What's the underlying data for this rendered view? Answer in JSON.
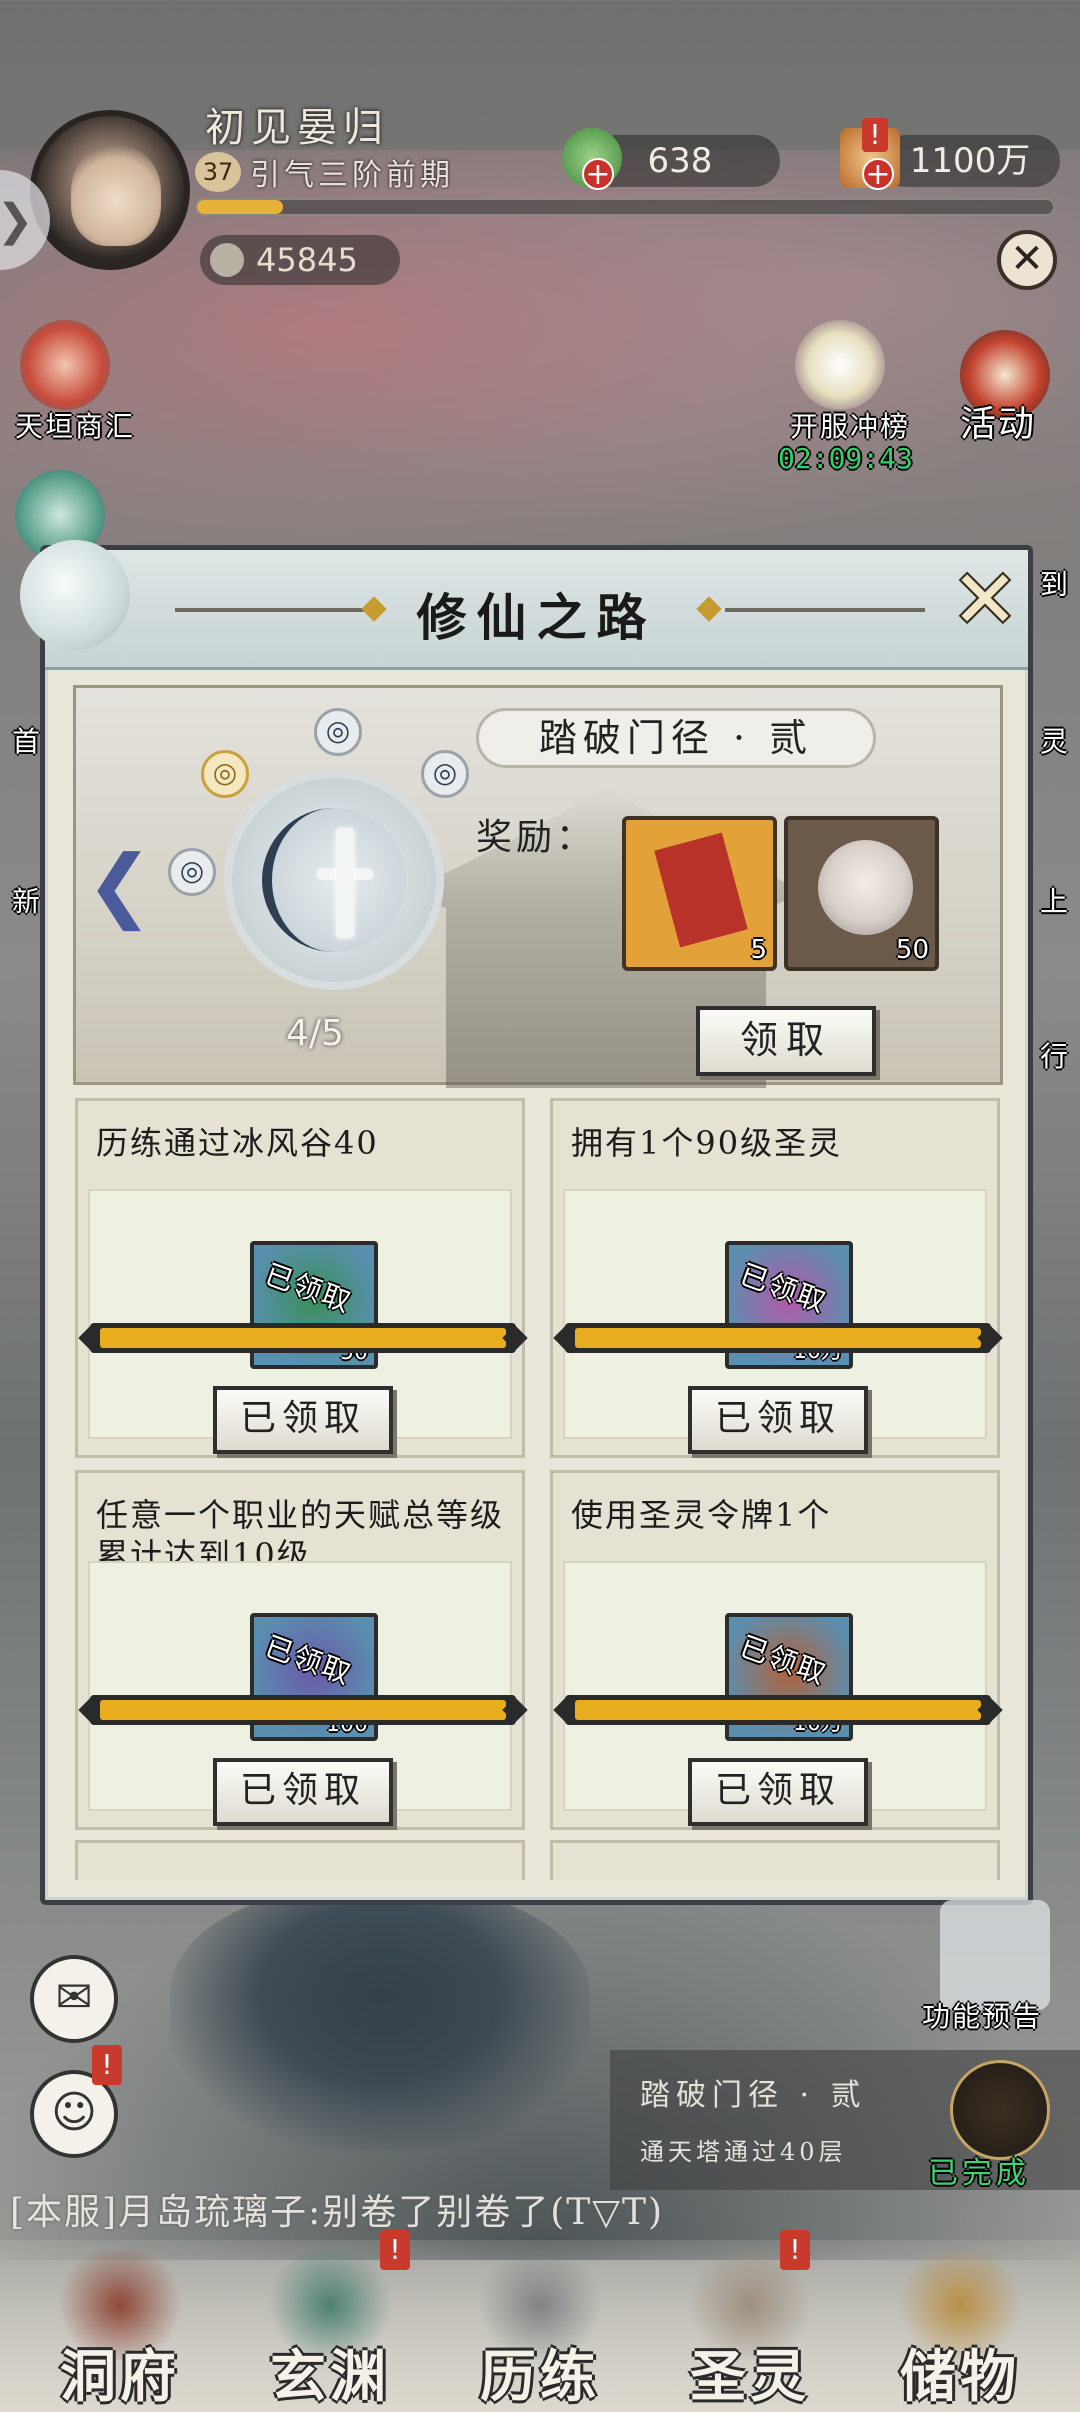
{
  "player": {
    "name": "初见晏归",
    "level": "37",
    "realm": "引气三阶前期",
    "exp_ratio": 0.1,
    "power": "45845"
  },
  "resources": {
    "jade": "638",
    "coins": "1100万"
  },
  "side_left": {
    "shop_label": "天垣商汇",
    "edge_chars": [
      "首",
      "新"
    ]
  },
  "side_right": {
    "ranking_label": "开服冲榜",
    "ranking_timer": "02:09:43",
    "activity_label": "活动",
    "edge_chars": [
      "到",
      "灵",
      "上",
      "行"
    ]
  },
  "modal": {
    "title": "修仙之路",
    "close_icon": "close-icon",
    "stage": {
      "name": "踏破门径 · 贰",
      "reward_label": "奖励：",
      "progress": "4/5",
      "claim_label": "领取",
      "rewards": [
        {
          "icon": "talisman-icon",
          "count": "5",
          "color": "#e3a13a"
        },
        {
          "icon": "spirit-character-icon",
          "count": "50",
          "color": "#6b5a4a"
        }
      ]
    },
    "tasks": [
      {
        "title": "历练通过冰风谷40",
        "claimed_tag": "已领取",
        "count": "50",
        "icon_color": "#3a8f5a",
        "progress": 1.0,
        "button": "已领取"
      },
      {
        "title": "拥有1个90级圣灵",
        "claimed_tag": "已领取",
        "count": "10万",
        "icon_color": "#b25aa6",
        "progress": 1.0,
        "button": "已领取"
      },
      {
        "title": "任意一个职业的天赋总等级累计达到10级",
        "claimed_tag": "已领取",
        "count": "100",
        "icon_color": "#6a5aa8",
        "progress": 1.0,
        "button": "已领取"
      },
      {
        "title": "使用圣灵令牌1个",
        "claimed_tag": "已领取",
        "count": "10万",
        "icon_color": "#b2623a",
        "progress": 1.0,
        "button": "已领取"
      }
    ]
  },
  "feature_preview_label": "功能预告",
  "quest_tracker": {
    "title": "踏破门径 · 贰",
    "desc": "通天塔通过40层",
    "status": "已完成"
  },
  "chat": "[本服]月岛琉璃子:别卷了别卷了(T▽T)",
  "bottom_nav": [
    {
      "label": "洞府",
      "color": "#8a3b2a"
    },
    {
      "label": "玄渊",
      "color": "#3f7a6a"
    },
    {
      "label": "历练",
      "color": "#7a7c80"
    },
    {
      "label": "圣灵",
      "color": "#9a8a7a"
    },
    {
      "label": "储物",
      "color": "#b98a3a"
    }
  ]
}
